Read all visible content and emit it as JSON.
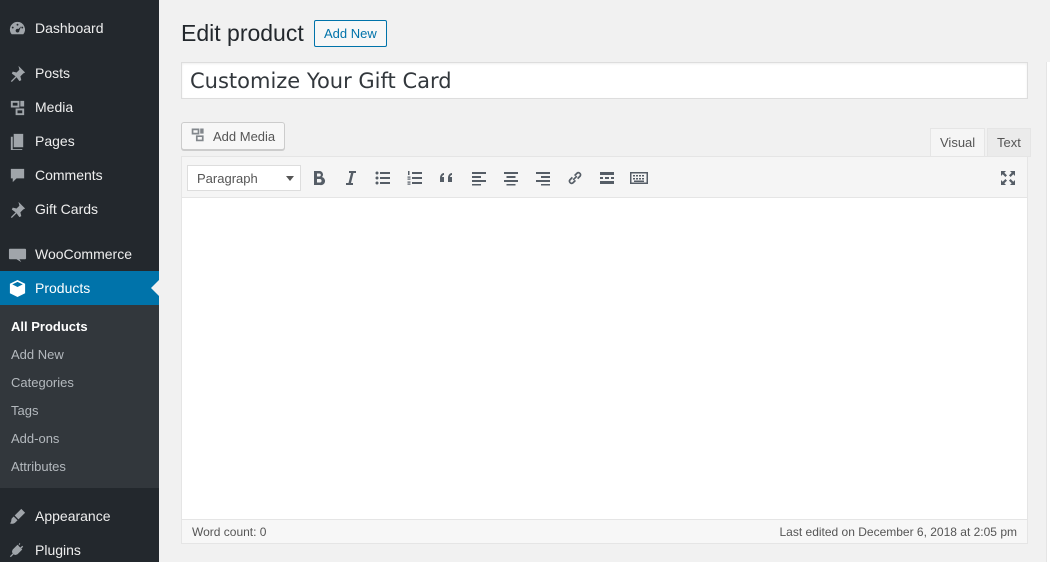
{
  "sidebar": {
    "items": [
      {
        "label": "Dashboard",
        "icon": "dashboard-icon"
      },
      {
        "label": "Posts",
        "icon": "pin-icon"
      },
      {
        "label": "Media",
        "icon": "media-icon"
      },
      {
        "label": "Pages",
        "icon": "pages-icon"
      },
      {
        "label": "Comments",
        "icon": "comment-icon"
      },
      {
        "label": "Gift Cards",
        "icon": "pin-icon"
      },
      {
        "label": "WooCommerce",
        "icon": "woocommerce-icon"
      },
      {
        "label": "Products",
        "icon": "box-icon",
        "current": true
      },
      {
        "label": "Appearance",
        "icon": "brush-icon"
      },
      {
        "label": "Plugins",
        "icon": "plug-icon"
      }
    ],
    "submenu": [
      "All Products",
      "Add New",
      "Categories",
      "Tags",
      "Add-ons",
      "Attributes"
    ]
  },
  "header": {
    "title": "Edit product",
    "add_new_label": "Add New"
  },
  "product": {
    "title_value": "Customize Your Gift Card"
  },
  "editor": {
    "add_media_label": "Add Media",
    "tab_visual": "Visual",
    "tab_text": "Text",
    "format_value": "Paragraph",
    "word_count": "Word count: 0",
    "last_edited": "Last edited on December 6, 2018 at 2:05 pm"
  },
  "colors": {
    "sidebar_bg": "#23282d",
    "submenu_bg": "#32373c",
    "accent": "#0073aa",
    "page_bg": "#f1f1f1"
  }
}
